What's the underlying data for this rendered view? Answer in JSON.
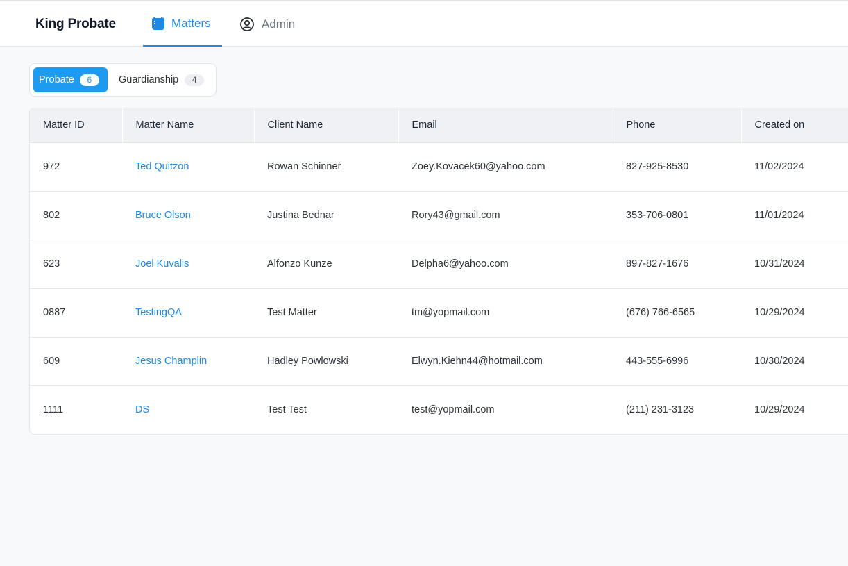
{
  "app": {
    "title": "King Probate"
  },
  "nav": {
    "matters": "Matters",
    "admin": "Admin"
  },
  "segments": {
    "probate": {
      "label": "Probate",
      "count": "6"
    },
    "guardianship": {
      "label": "Guardianship",
      "count": "4"
    }
  },
  "table": {
    "columns": [
      "Matter ID",
      "Matter Name",
      "Client Name",
      "Email",
      "Phone",
      "Created on"
    ],
    "rows": [
      {
        "id": "972",
        "matter": "Ted Quitzon",
        "client": "Rowan Schinner",
        "email": "Zoey.Kovacek60@yahoo.com",
        "phone": "827-925-8530",
        "created": "11/02/2024"
      },
      {
        "id": "802",
        "matter": "Bruce Olson",
        "client": "Justina Bednar",
        "email": "Rory43@gmail.com",
        "phone": "353-706-0801",
        "created": "11/01/2024"
      },
      {
        "id": "623",
        "matter": "Joel Kuvalis",
        "client": "Alfonzo Kunze",
        "email": "Delpha6@yahoo.com",
        "phone": "897-827-1676",
        "created": "10/31/2024"
      },
      {
        "id": "0887",
        "matter": "TestingQA",
        "client": "Test Matter",
        "email": "tm@yopmail.com",
        "phone": "(676) 766-6565",
        "created": "10/29/2024"
      },
      {
        "id": "609",
        "matter": "Jesus Champlin",
        "client": "Hadley Powlowski",
        "email": "Elwyn.Kiehn44@hotmail.com",
        "phone": "443-555-6996",
        "created": "10/30/2024"
      },
      {
        "id": "1111",
        "matter": "DS",
        "client": "Test Test",
        "email": "test@yopmail.com",
        "phone": "(211) 231-3123",
        "created": "10/29/2024"
      }
    ]
  },
  "colors": {
    "accent": "#1e88e5",
    "segment_active": "#1d9bf0"
  },
  "icons": {
    "matters": "list-icon",
    "admin": "user-circle-icon"
  }
}
